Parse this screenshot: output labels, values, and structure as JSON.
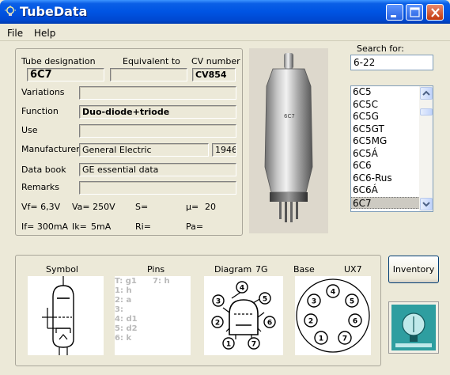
{
  "window": {
    "title": "TubeData"
  },
  "menu": {
    "file": "File",
    "help": "Help"
  },
  "details": {
    "designation_label": "Tube designation",
    "equivalent_label": "Equivalent to",
    "cv_label": "CV number",
    "designation": "6C7",
    "equivalent": "",
    "cv_number": "CV854",
    "variations_label": "Variations",
    "variations": "",
    "function_label": "Function",
    "function": "Duo-diode+triode",
    "use_label": "Use",
    "use": "",
    "manufacturer_label": "Manufacturer",
    "manufacturer": "General Electric",
    "year": "1946",
    "databook_label": "Data book",
    "databook": "GE essential data",
    "remarks_label": "Remarks",
    "remarks": ""
  },
  "params": {
    "vf": "Vf= 6,3V",
    "va": "Va= 250V",
    "s": "S=",
    "mu_label": "µ=",
    "mu": "20",
    "if": "If= 300mA",
    "ik_label": "Ik=",
    "ik": "5mA",
    "ri": "Ri=",
    "pa": "Pa="
  },
  "search": {
    "label": "Search for:",
    "value": "6-22"
  },
  "tube_list": [
    "6C5",
    "6C5C",
    "6C5G",
    "6C5GT",
    "6C5MG",
    "6C5Á",
    "6C6",
    "6C6-Rus",
    "6C6Á",
    "6C7"
  ],
  "selected_tube": "6C7",
  "bottom": {
    "symbol_label": "Symbol",
    "pins_label": "Pins",
    "diagram_label": "Diagram",
    "diagram_code": "7G",
    "base_label": "Base",
    "base_code": "UX7",
    "pins": [
      [
        "T: g1",
        "7: h"
      ],
      [
        "1: h",
        ""
      ],
      [
        "2: a",
        ""
      ],
      [
        "3:",
        ""
      ],
      [
        "4: d1",
        ""
      ],
      [
        "5: d2",
        ""
      ],
      [
        "6: k",
        ""
      ]
    ],
    "diagram_pin_numbers": [
      "1",
      "2",
      "3",
      "4",
      "5",
      "6",
      "7"
    ],
    "base_pin_numbers": [
      "1",
      "2",
      "3",
      "4",
      "5",
      "6",
      "7"
    ]
  },
  "inventory_button": "Inventory",
  "icons": {
    "app": "lightbulb-icon",
    "minimize": "minimize-icon",
    "maximize": "maximize-icon",
    "close": "close-icon"
  },
  "colors": {
    "titlebar": "#0054e3",
    "close_button": "#c2380d",
    "selection": "#cdcac2"
  }
}
